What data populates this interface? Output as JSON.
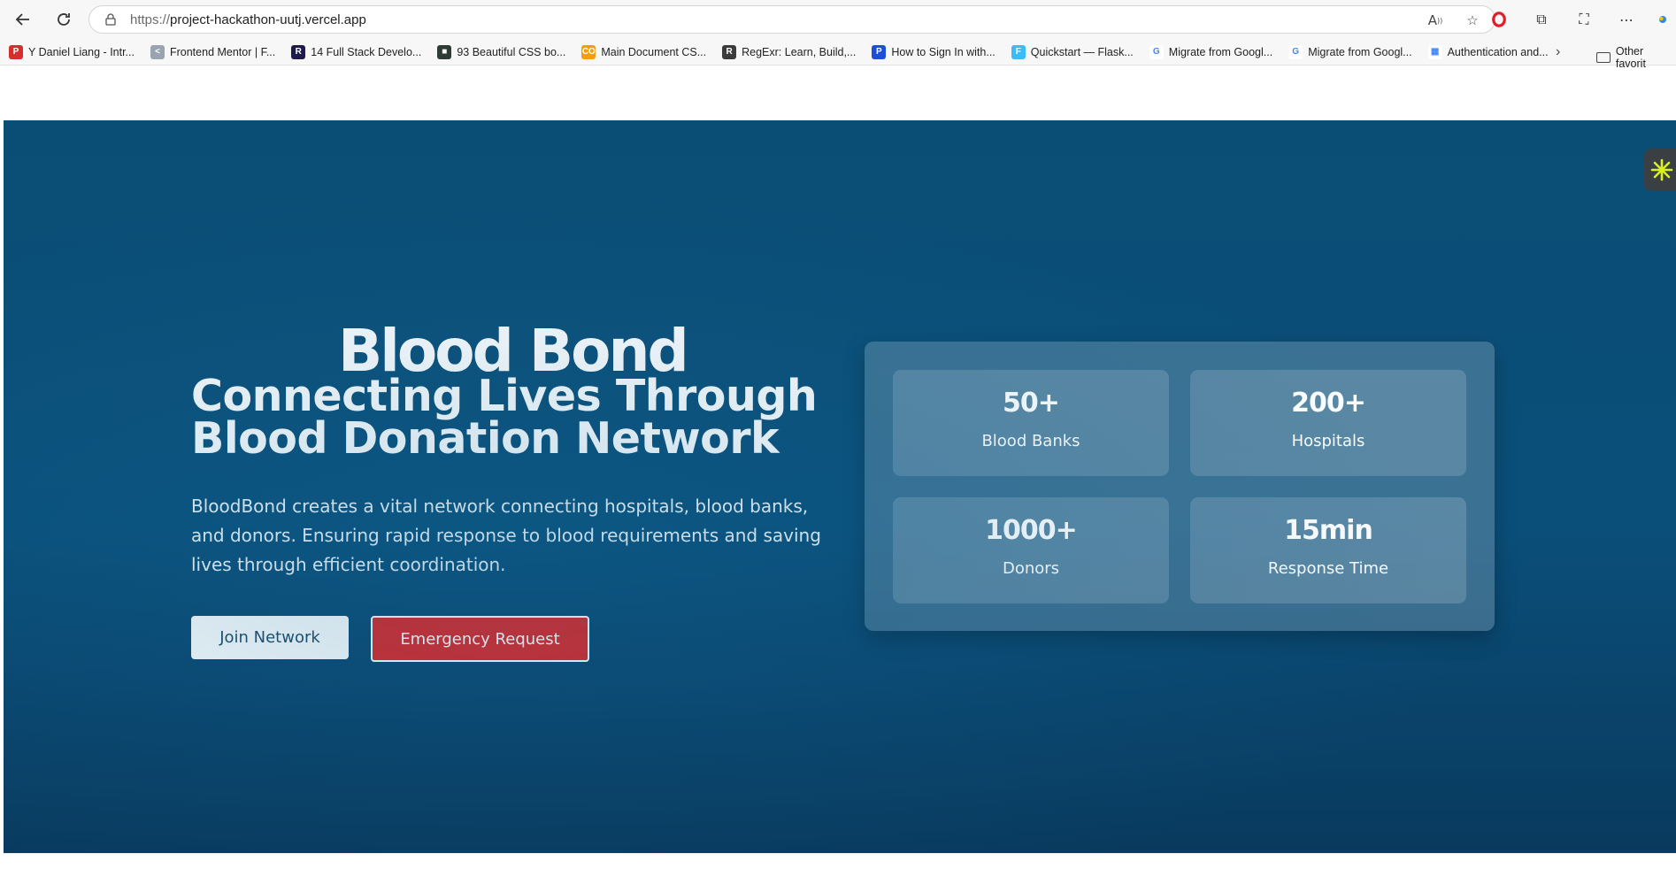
{
  "browser": {
    "url_scheme": "https://",
    "url_host": "project-hackathon-uutj.vercel.app"
  },
  "bookmarks": [
    {
      "label": "Y Daniel Liang - Intr...",
      "icon": "pdf-icon",
      "color": "#d32f2f",
      "glyph": "P"
    },
    {
      "label": "Frontend Mentor | F...",
      "icon": "frontend-mentor-icon",
      "color": "#9aa4b0",
      "glyph": "<"
    },
    {
      "label": "14 Full Stack Develo...",
      "icon": "r-letter-icon",
      "color": "#1e1b4b",
      "glyph": "R"
    },
    {
      "label": "93 Beautiful CSS bo...",
      "icon": "css-icon",
      "color": "#2f3b35",
      "glyph": "■"
    },
    {
      "label": "Main Document CS...",
      "icon": "co-icon",
      "color": "#f59e0b",
      "glyph": "CO"
    },
    {
      "label": "RegExr: Learn, Build,...",
      "icon": "regexr-icon",
      "color": "#3b3b3b",
      "glyph": "R"
    },
    {
      "label": "How to Sign In with...",
      "icon": "passport-icon",
      "color": "#1d4ed8",
      "glyph": "P"
    },
    {
      "label": "Quickstart — Flask...",
      "icon": "flask-icon",
      "color": "#38bdf8",
      "glyph": "F"
    },
    {
      "label": "Migrate from Googl...",
      "icon": "google-icon",
      "color": "#ffffff",
      "glyph": "G"
    },
    {
      "label": "Migrate from Googl...",
      "icon": "google-icon",
      "color": "#ffffff",
      "glyph": "G"
    },
    {
      "label": "Authentication and...",
      "icon": "microsoft-icon",
      "color": "#ffffff",
      "glyph": "▦"
    }
  ],
  "bookmarks_other": "Other favorit",
  "hero": {
    "brand": "Blood Bond",
    "subtitle": "Connecting Lives Through Blood Donation Network",
    "description": "BloodBond creates a vital network connecting hospitals, blood banks, and donors. Ensuring rapid response to blood requirements and saving lives through efficient coordination.",
    "join_button": "Join Network",
    "emergency_button": "Emergency Request"
  },
  "stats": [
    {
      "value": "50+",
      "label": "Blood Banks"
    },
    {
      "value": "200+",
      "label": "Hospitals"
    },
    {
      "value": "1000+",
      "label": "Donors"
    },
    {
      "value": "15min",
      "label": "Response Time"
    }
  ],
  "colors": {
    "hero_bg": "#0a4f7a",
    "emergency": "#dc2626",
    "widget_star": "#d9f021"
  }
}
